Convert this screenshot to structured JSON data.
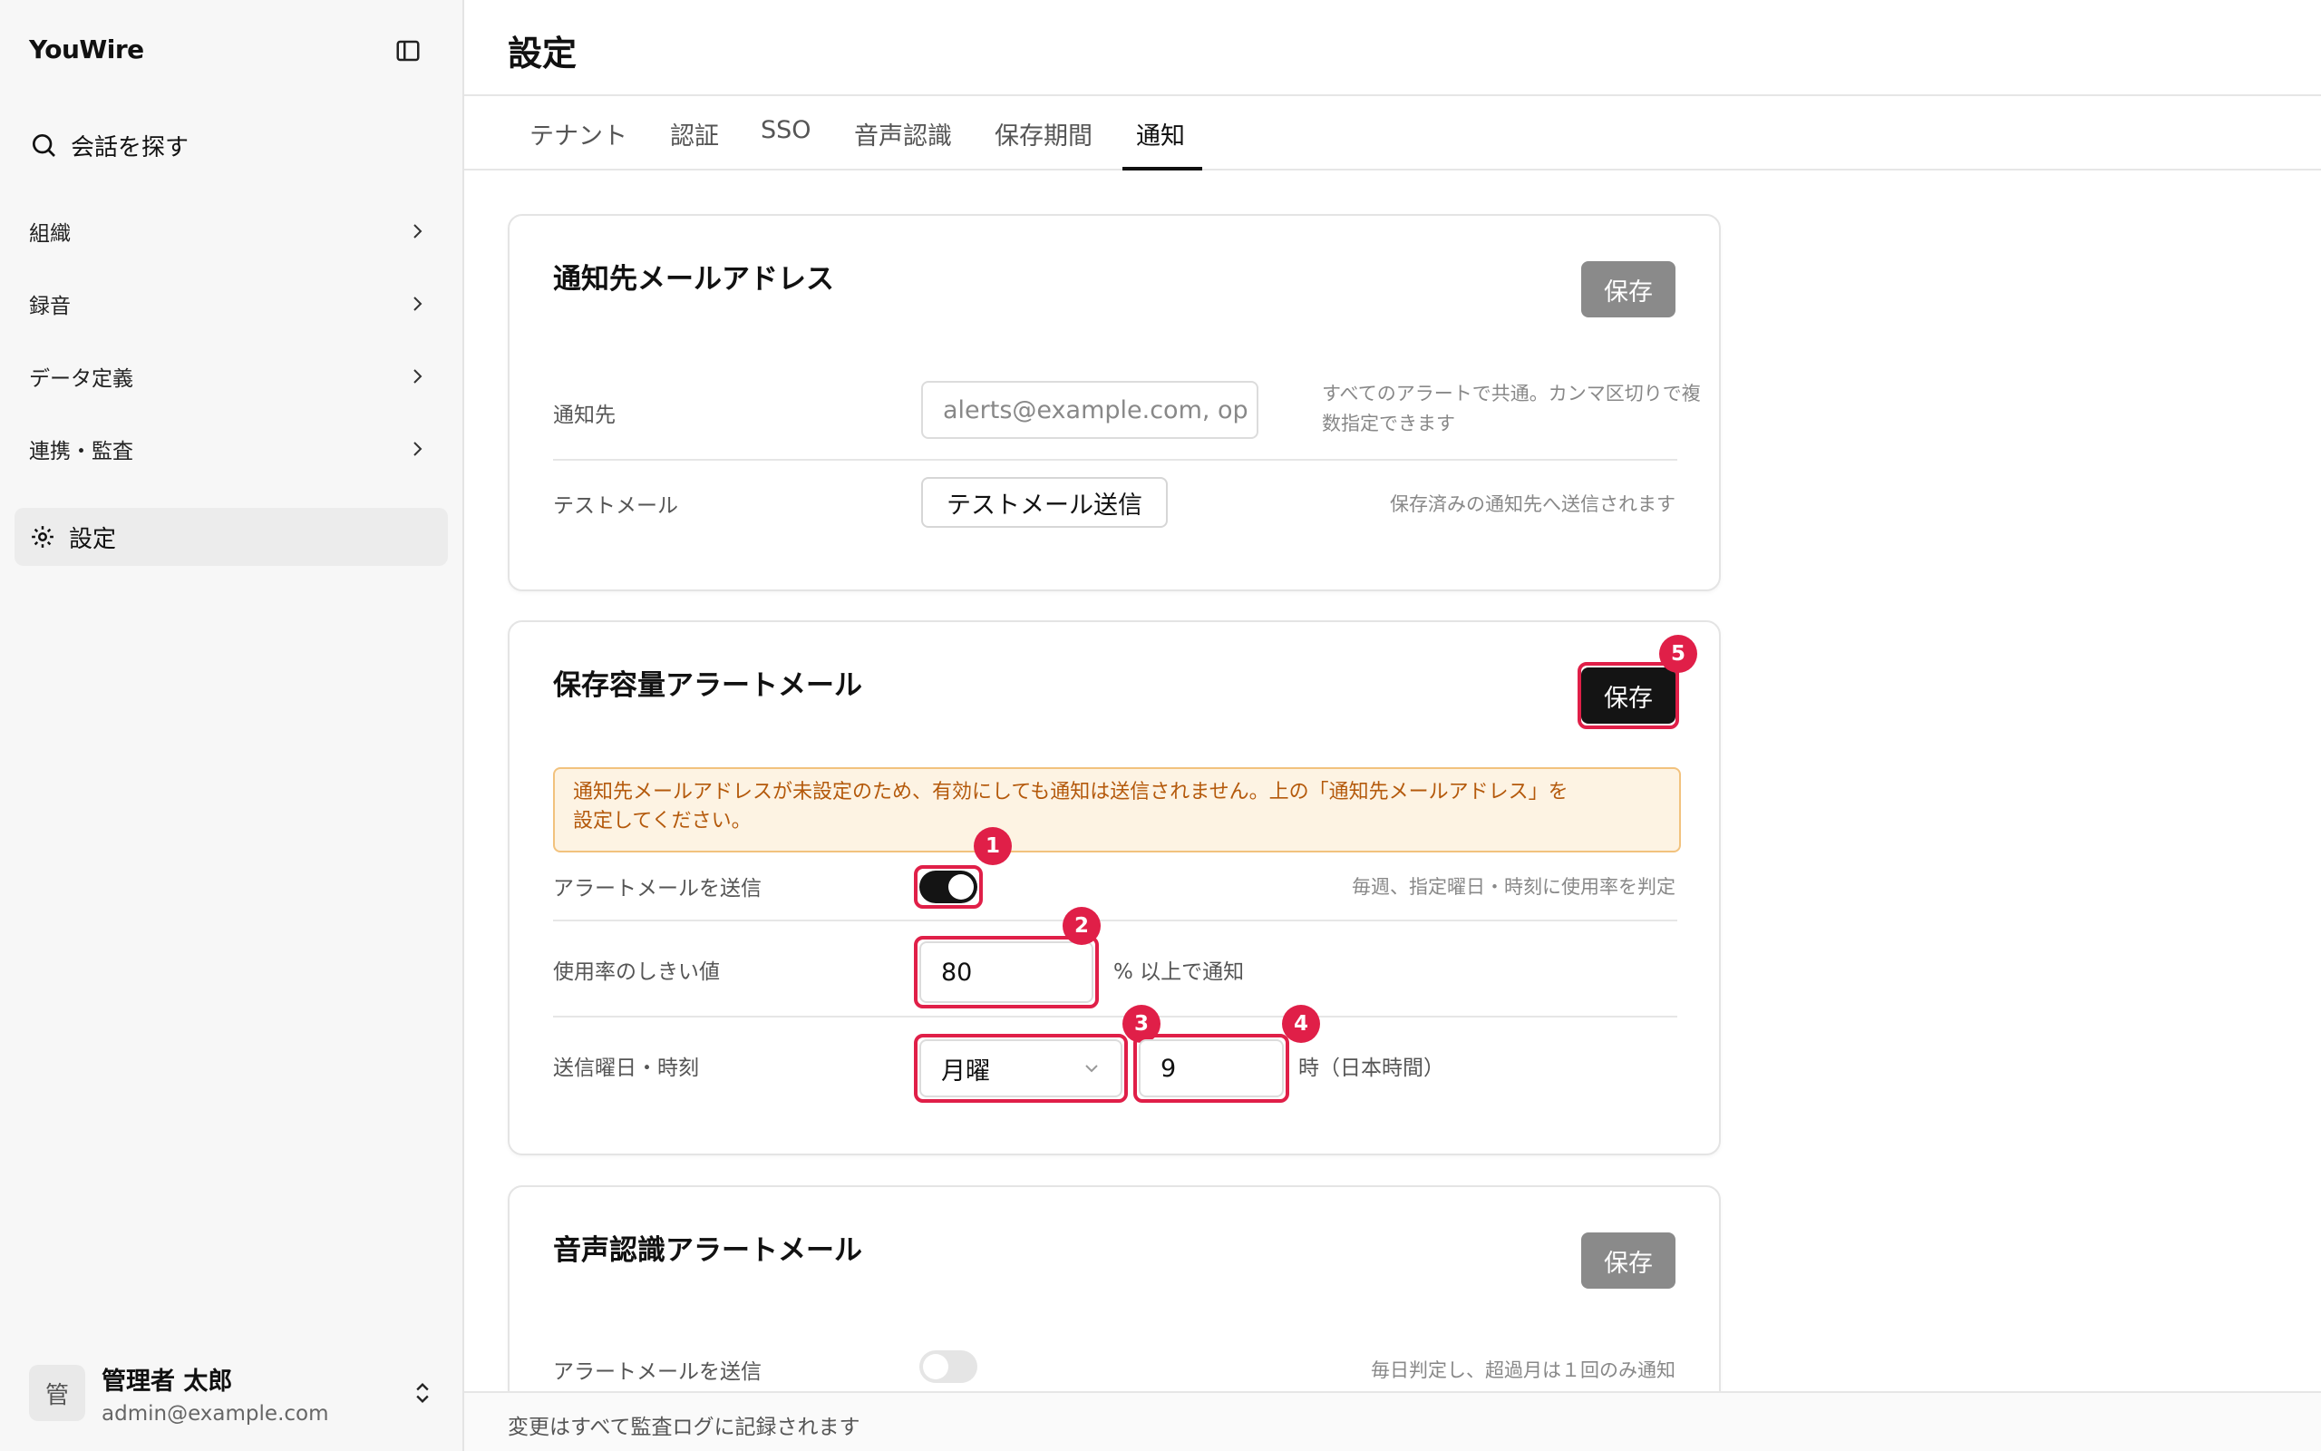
{
  "app": {
    "name": "YouWire"
  },
  "sidebar": {
    "search_label": "会話を探す",
    "items": [
      {
        "label": "組織"
      },
      {
        "label": "録音"
      },
      {
        "label": "データ定義"
      },
      {
        "label": "連携・監査"
      }
    ],
    "settings_label": "設定",
    "user": {
      "avatar": "管",
      "name": "管理者 太郎",
      "email": "admin@example.com"
    }
  },
  "header": {
    "title": "設定"
  },
  "tabs": [
    {
      "label": "テナント"
    },
    {
      "label": "認証"
    },
    {
      "label": "SSO"
    },
    {
      "label": "音声認識"
    },
    {
      "label": "保存期間"
    },
    {
      "label": "通知",
      "active": true
    }
  ],
  "email_card": {
    "title": "通知先メールアドレス",
    "save_label": "保存",
    "recipient": {
      "label": "通知先",
      "value": "",
      "placeholder": "alerts@example.com, op",
      "hint_line1": "すべてのアラートで共通。カンマ区切りで複",
      "hint_line2": "数指定できます"
    },
    "test": {
      "label": "テストメール",
      "button": "テストメール送信",
      "hint": "保存済みの通知先へ送信されます"
    }
  },
  "storage_card": {
    "title": "保存容量アラートメール",
    "save_label": "保存",
    "warning_line1": "通知先メールアドレスが未設定のため、有効にしても通知は送信されません。上の「通知先メールアドレス」を",
    "warning_line2": "設定してください。",
    "send": {
      "label": "アラートメールを送信",
      "enabled": true,
      "hint": "毎週、指定曜日・時刻に使用率を判定"
    },
    "threshold": {
      "label": "使用率のしきい値",
      "value": "80",
      "unit": "% 以上で通知"
    },
    "schedule": {
      "label": "送信曜日・時刻",
      "day": "月曜",
      "hour": "9",
      "unit": "時（日本時間）"
    }
  },
  "speech_card": {
    "title": "音声認識アラートメール",
    "save_label": "保存",
    "send": {
      "label": "アラートメールを送信",
      "enabled": false,
      "hint": "毎日判定し、超過月は１回のみ通知"
    }
  },
  "annotations": [
    "1",
    "2",
    "3",
    "4",
    "5"
  ],
  "footer": {
    "text": "変更はすべて監査ログに記録されます"
  },
  "colors": {
    "accent": "#e01f48",
    "warning_bg": "#fdf3e3",
    "warning_text": "#b4590b",
    "primary": "#141414"
  }
}
